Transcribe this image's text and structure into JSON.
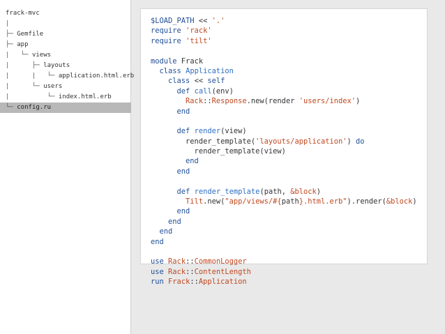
{
  "file_tree": [
    {
      "prefix": "",
      "name": "frack-mvc"
    },
    {
      "prefix": "|",
      "name": ""
    },
    {
      "prefix": "├─ ",
      "name": "Gemfile"
    },
    {
      "prefix": "├─ ",
      "name": "app"
    },
    {
      "prefix": "|   └─ ",
      "name": "views"
    },
    {
      "prefix": "|      ├─ ",
      "name": "layouts"
    },
    {
      "prefix": "|      |   └─ ",
      "name": "application.html.erb"
    },
    {
      "prefix": "|      └─ ",
      "name": "users"
    },
    {
      "prefix": "|          └─ ",
      "name": "index.html.erb"
    },
    {
      "prefix": "└─ ",
      "name": "config.ru",
      "selected": true
    }
  ],
  "code": [
    [
      [
        "t-gvar",
        "$LOAD_PATH"
      ],
      [
        "t-plain",
        " << "
      ],
      [
        "t-str",
        "'.'"
      ]
    ],
    [
      [
        "t-kw",
        "require"
      ],
      [
        "t-plain",
        " "
      ],
      [
        "t-str",
        "'rack'"
      ]
    ],
    [
      [
        "t-kw",
        "require"
      ],
      [
        "t-plain",
        " "
      ],
      [
        "t-str",
        "'tilt'"
      ]
    ],
    [],
    [
      [
        "t-kw",
        "module"
      ],
      [
        "t-plain",
        " Frack"
      ]
    ],
    [
      [
        "t-plain",
        "  "
      ],
      [
        "t-kw",
        "class"
      ],
      [
        "t-plain",
        " "
      ],
      [
        "t-meth",
        "Application"
      ]
    ],
    [
      [
        "t-plain",
        "    "
      ],
      [
        "t-kw",
        "class"
      ],
      [
        "t-plain",
        " << "
      ],
      [
        "t-kw",
        "self"
      ]
    ],
    [
      [
        "t-plain",
        "      "
      ],
      [
        "t-kw",
        "def"
      ],
      [
        "t-plain",
        " "
      ],
      [
        "t-meth",
        "call"
      ],
      [
        "t-plain",
        "(env)"
      ]
    ],
    [
      [
        "t-plain",
        "        "
      ],
      [
        "t-const",
        "Rack"
      ],
      [
        "t-plain",
        "::"
      ],
      [
        "t-const",
        "Response"
      ],
      [
        "t-plain",
        ".new(render "
      ],
      [
        "t-str",
        "'users/index'"
      ],
      [
        "t-plain",
        ")"
      ]
    ],
    [
      [
        "t-plain",
        "      "
      ],
      [
        "t-kw",
        "end"
      ]
    ],
    [],
    [
      [
        "t-plain",
        "      "
      ],
      [
        "t-kw",
        "def"
      ],
      [
        "t-plain",
        " "
      ],
      [
        "t-meth",
        "render"
      ],
      [
        "t-plain",
        "(view)"
      ]
    ],
    [
      [
        "t-plain",
        "        render_template("
      ],
      [
        "t-str",
        "'layouts/application'"
      ],
      [
        "t-plain",
        ") "
      ],
      [
        "t-kw",
        "do"
      ]
    ],
    [
      [
        "t-plain",
        "          render_template(view)"
      ]
    ],
    [
      [
        "t-plain",
        "        "
      ],
      [
        "t-kw",
        "end"
      ]
    ],
    [
      [
        "t-plain",
        "      "
      ],
      [
        "t-kw",
        "end"
      ]
    ],
    [],
    [
      [
        "t-plain",
        "      "
      ],
      [
        "t-kw",
        "def"
      ],
      [
        "t-plain",
        " "
      ],
      [
        "t-meth",
        "render_template"
      ],
      [
        "t-plain",
        "(path, "
      ],
      [
        "t-sym",
        "&block"
      ],
      [
        "t-plain",
        ")"
      ]
    ],
    [
      [
        "t-plain",
        "        "
      ],
      [
        "t-const",
        "Tilt"
      ],
      [
        "t-plain",
        ".new("
      ],
      [
        "t-str",
        "\"app/views/#{"
      ],
      [
        "t-plain",
        "path"
      ],
      [
        "t-str",
        "}.html.erb\""
      ],
      [
        "t-plain",
        ").render("
      ],
      [
        "t-sym",
        "&block"
      ],
      [
        "t-plain",
        ")"
      ]
    ],
    [
      [
        "t-plain",
        "      "
      ],
      [
        "t-kw",
        "end"
      ]
    ],
    [
      [
        "t-plain",
        "    "
      ],
      [
        "t-kw",
        "end"
      ]
    ],
    [
      [
        "t-plain",
        "  "
      ],
      [
        "t-kw",
        "end"
      ]
    ],
    [
      [
        "t-kw",
        "end"
      ]
    ],
    [],
    [
      [
        "t-kw",
        "use"
      ],
      [
        "t-plain",
        " "
      ],
      [
        "t-const",
        "Rack"
      ],
      [
        "t-plain",
        "::"
      ],
      [
        "t-const",
        "CommonLogger"
      ]
    ],
    [
      [
        "t-kw",
        "use"
      ],
      [
        "t-plain",
        " "
      ],
      [
        "t-const",
        "Rack"
      ],
      [
        "t-plain",
        "::"
      ],
      [
        "t-const",
        "ContentLength"
      ]
    ],
    [
      [
        "t-kw",
        "run"
      ],
      [
        "t-plain",
        " "
      ],
      [
        "t-const",
        "Frack"
      ],
      [
        "t-plain",
        "::"
      ],
      [
        "t-const",
        "Application"
      ]
    ]
  ]
}
